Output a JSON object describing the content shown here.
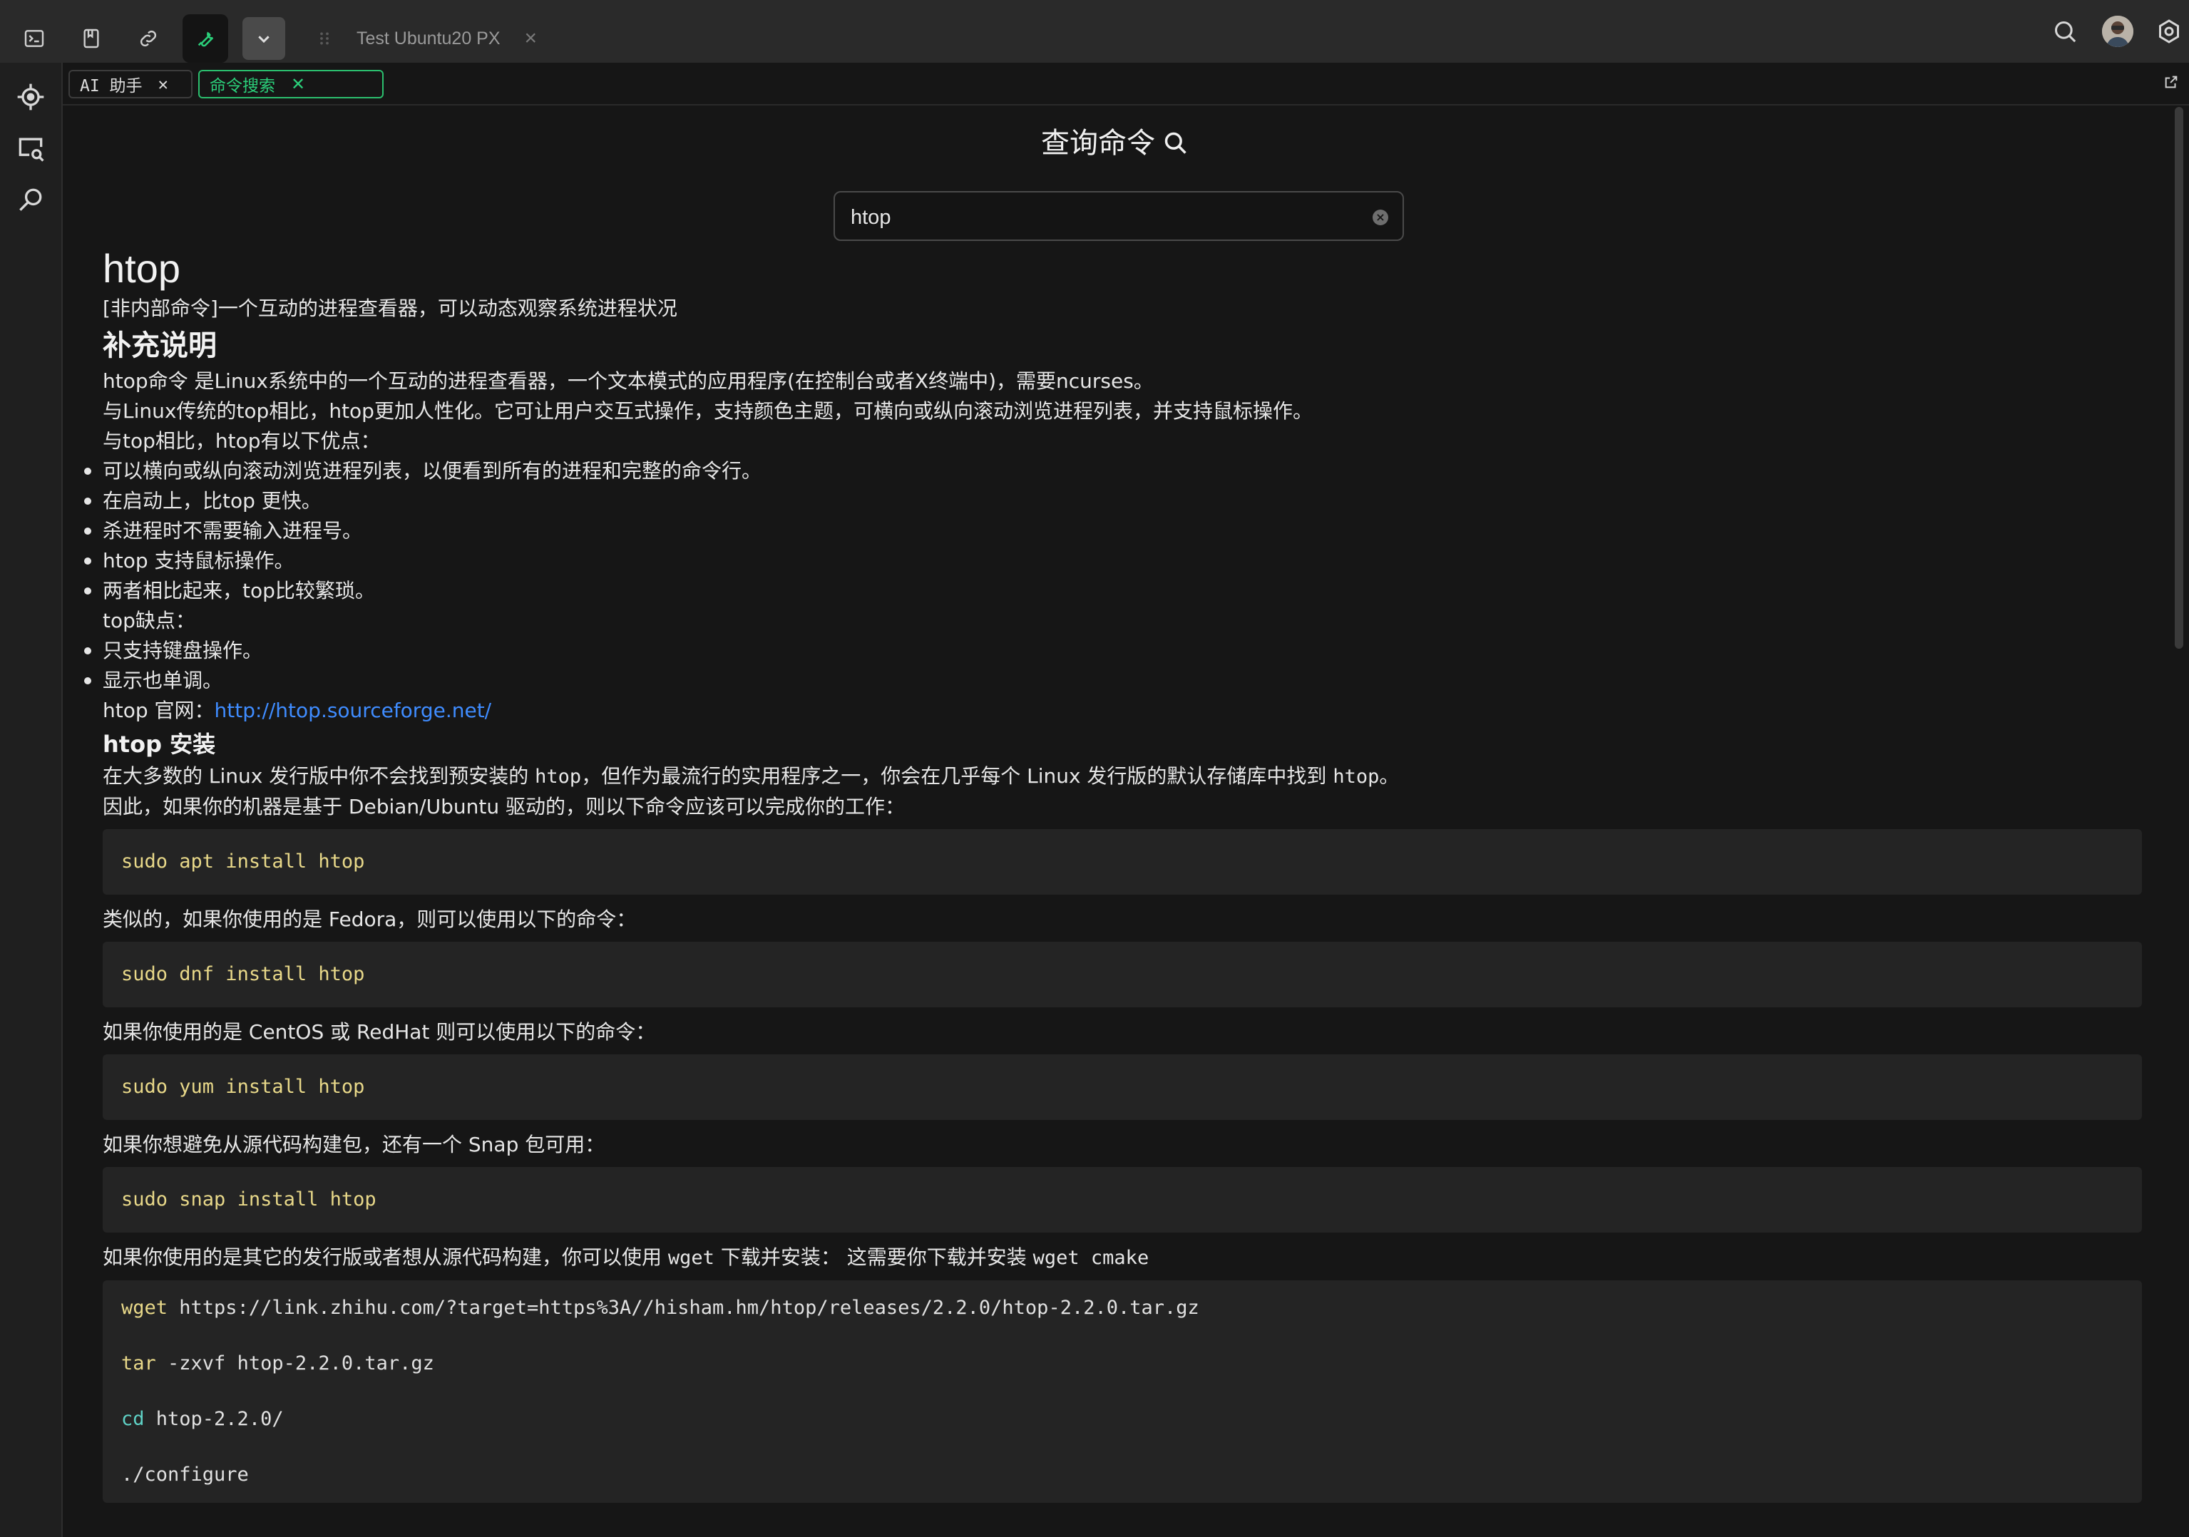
{
  "topbar": {
    "session_tab_title": "Test Ubuntu20 PX",
    "session_tab_close": "×"
  },
  "subtabs": {
    "ai_label": "AI 助手",
    "cmd_label": "命令搜索",
    "close_glyph": "✕"
  },
  "search": {
    "heading": "查询命令",
    "value": "htop"
  },
  "doc": {
    "title": "htop",
    "summary": "[非内部命令]一个互动的进程查看器，可以动态观察系统进程状况",
    "h_supplement": "补充说明",
    "p1": "htop命令 是Linux系统中的一个互动的进程查看器，一个文本模式的应用程序(在控制台或者X终端中)，需要ncurses。",
    "p2": "与Linux传统的top相比，htop更加人性化。它可让用户交互式操作，支持颜色主题，可横向或纵向滚动浏览进程列表，并支持鼠标操作。",
    "p3": "与top相比，htop有以下优点：",
    "advantages": [
      "可以横向或纵向滚动浏览进程列表，以便看到所有的进程和完整的命令行。",
      "在启动上，比top 更快。",
      "杀进程时不需要输入进程号。",
      "htop 支持鼠标操作。",
      "两者相比起来，top比较繁琐。"
    ],
    "p4": "top缺点：",
    "disadvantages": [
      "只支持键盘操作。",
      "显示也单调。"
    ],
    "site_label": "htop 官网：",
    "site_url": "http://htop.sourceforge.net/",
    "h_install": "htop 安装",
    "i1_a": "在大多数的 Linux 发行版中你不会找到预安装的 ",
    "i1_code1": "htop",
    "i1_b": "，但作为最流行的实用程序之一，你会在几乎每个 Linux 发行版的默认存储库中找到 ",
    "i1_code2": "htop",
    "i1_c": "。",
    "i2": "因此，如果你的机器是基于 Debian/Ubuntu 驱动的，则以下命令应该可以完成你的工作：",
    "code_apt_cmd": "sudo",
    "code_apt_rest": " apt install htop",
    "i3": "类似的，如果你使用的是 Fedora，则可以使用以下的命令：",
    "code_dnf_cmd": "sudo",
    "code_dnf_rest": " dnf install htop",
    "i4": "如果你使用的是 CentOS 或 RedHat 则可以使用以下的命令：",
    "code_yum_cmd": "sudo",
    "code_yum_rest": " yum install htop",
    "i5": "如果你想避免从源代码构建包，还有一个 Snap 包可用：",
    "code_snap_cmd": "sudo",
    "code_snap_rest": " snap install htop",
    "i6_a": "如果你使用的是其它的发行版或者想从源代码构建，你可以使用 ",
    "i6_code1": "wget",
    "i6_b": " 下载并安装： 这需要你下载并安装 ",
    "i6_code2": "wget cmake",
    "src_lines": [
      {
        "cmd": "wget",
        "rest": " https://link.zhihu.com/?target=https%3A//hisham.hm/htop/releases/2.2.0/htop-2.2.0.tar.gz"
      },
      {
        "cmd": "tar",
        "rest": " -zxvf htop-2.2.0.tar.gz"
      },
      {
        "cmd": "cd",
        "rest": " htop-2.2.0/"
      },
      {
        "cmd": "",
        "rest": "./configure"
      }
    ]
  }
}
